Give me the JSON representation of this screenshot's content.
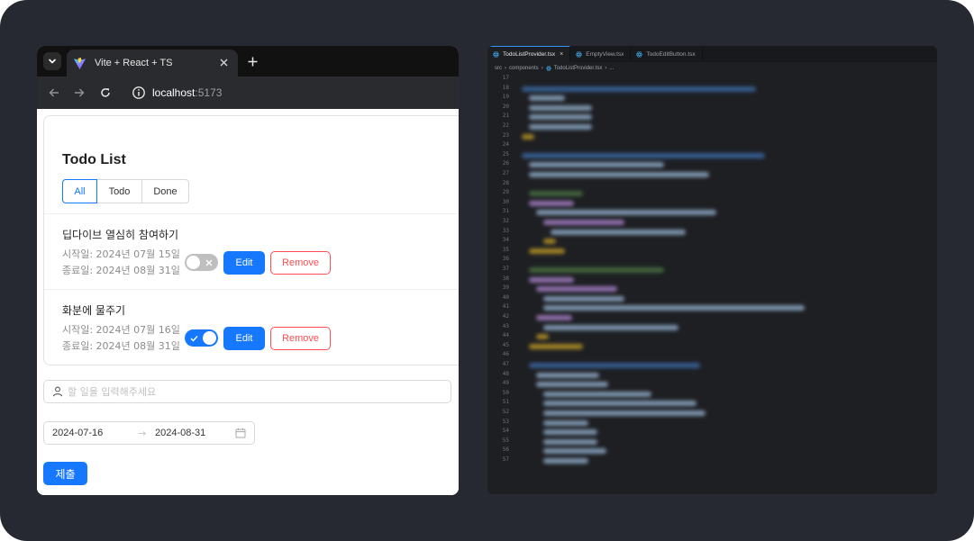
{
  "browser": {
    "tab_title": "Vite + React + TS",
    "url_host": "localhost",
    "url_port": ":5173"
  },
  "todo_app": {
    "title": "Todo List",
    "filters": [
      "All",
      "Todo",
      "Done"
    ],
    "active_filter": "All",
    "items": [
      {
        "title": "딥다이브 열심히 참여하기",
        "start_date": "시작일: 2024년 07월 15일",
        "end_date": "종료일: 2024년 08월 31일",
        "done": false,
        "edit_label": "Edit",
        "remove_label": "Remove"
      },
      {
        "title": "화분에 물주기",
        "start_date": "시작일: 2024년 07월 16일",
        "end_date": "종료일: 2024년 08월 31일",
        "done": true,
        "edit_label": "Edit",
        "remove_label": "Remove"
      }
    ],
    "input_placeholder": "할 일을 입력해주세요",
    "range": {
      "start": "2024-07-16",
      "end": "2024-08-31"
    },
    "submit_label": "제출"
  },
  "editor": {
    "tabs": [
      "TodoListProvider.tsx",
      "EmptyView.tsx",
      "TodoEditButton.tsx"
    ],
    "active_tab": "TodoListProvider.tsx",
    "breadcrumb": [
      "src",
      "components",
      "TodoListProvider.tsx",
      "..."
    ],
    "line_numbers": [
      "17",
      "18",
      "19",
      "20",
      "21",
      "22",
      "23",
      "24",
      "25",
      "26",
      "27",
      "28",
      "29",
      "30",
      "31",
      "32",
      "33",
      "34",
      "35",
      "36",
      "37",
      "38",
      "39",
      "40",
      "41",
      "42",
      "43",
      "44",
      "45",
      "46",
      "47",
      "48",
      "49",
      "50",
      "51",
      "52",
      "53",
      "54",
      "55",
      "56",
      "57"
    ]
  },
  "colors": {
    "frame": "#262932",
    "primary": "#1677ff",
    "danger": "#ff4d4f",
    "editor_bg": "#1e1f23"
  }
}
